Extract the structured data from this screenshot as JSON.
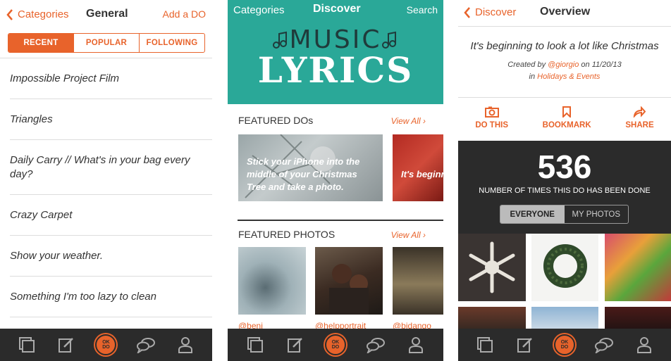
{
  "screen1": {
    "back_label": "Categories",
    "title": "General",
    "add_label": "Add a DO",
    "tabs": [
      "RECENT",
      "POPULAR",
      "FOLLOWING"
    ],
    "items": [
      "Impossible Project Film",
      "Triangles",
      "Daily Carry // What's in your bag every day?",
      "Crazy Carpet",
      "Show your weather.",
      "Something I'm too lazy to clean"
    ]
  },
  "screen2": {
    "left_label": "Categories",
    "title": "Discover",
    "right_label": "Search",
    "hero_top": "MUSIC",
    "hero_bottom": "LYRICS",
    "featured_dos_heading": "FEATURED DOs",
    "view_all": "View All",
    "featured_cards": [
      "Stick your iPhone into the middle of your Christmas Tree and take a photo.",
      "It's beginn Christmas"
    ],
    "featured_photos_heading": "FEATURED PHOTOS",
    "photo_handles": [
      "@benj",
      "@helpportrait",
      "@bidango"
    ]
  },
  "screen3": {
    "back_label": "Discover",
    "title": "Overview",
    "do_title": "It's beginning to look a lot like Christmas",
    "created_by_prefix": "Created by",
    "creator": "@giorgio",
    "date_text": "on 11/20/13",
    "in_prefix": "in",
    "category": "Holidays & Events",
    "actions": [
      "DO THIS",
      "BOOKMARK",
      "SHARE"
    ],
    "count": "536",
    "count_caption": "NUMBER OF TIMES THIS DO HAS BEEN DONE",
    "filters": [
      "EVERYONE",
      "MY PHOTOS"
    ]
  },
  "tabbar": {
    "okdo_line1": "OK",
    "okdo_line2": "DO",
    "icons": [
      "cards-icon",
      "compose-icon",
      "okdo-logo-icon",
      "chat-bubbles-icon",
      "profile-icon"
    ]
  },
  "colors": {
    "accent": "#e8632b",
    "teal": "#2aa898",
    "dark": "#2b2b2b"
  }
}
